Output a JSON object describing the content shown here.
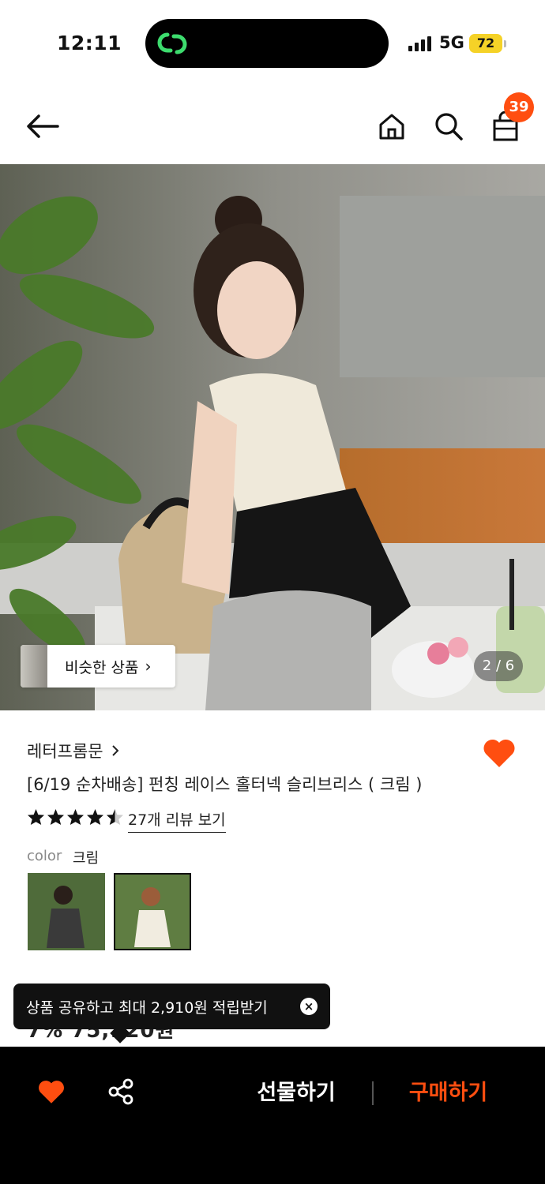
{
  "status_bar": {
    "time": "12:11",
    "network": "5G",
    "battery": "72",
    "battery_color": "#f5d227"
  },
  "nav": {
    "back_icon": "arrow-left-icon",
    "home_icon": "home-icon",
    "search_icon": "search-icon",
    "cart_icon": "shopping-bag-icon",
    "cart_count": "39"
  },
  "gallery": {
    "similar_label": "비슷한 상품",
    "page_indicator": "2 / 6"
  },
  "product": {
    "brand": "레터프롬문",
    "title": "[6/19 순차배송] 펀칭 레이스 홀터넥 슬리브리스 ( 크림 )",
    "rating": 4.5,
    "review_link": "27개 리뷰 보기",
    "color_label": "color",
    "color_value": "크림",
    "price_partial": "7% 75,120원"
  },
  "toast": {
    "text": "상품 공유하고 최대 2,910원 적립받기"
  },
  "bottom_bar": {
    "gift_label": "선물하기",
    "buy_label": "구매하기"
  },
  "colors": {
    "accent": "#ff4e10",
    "heart": "#ff4e10",
    "bar_background": "#000000"
  }
}
